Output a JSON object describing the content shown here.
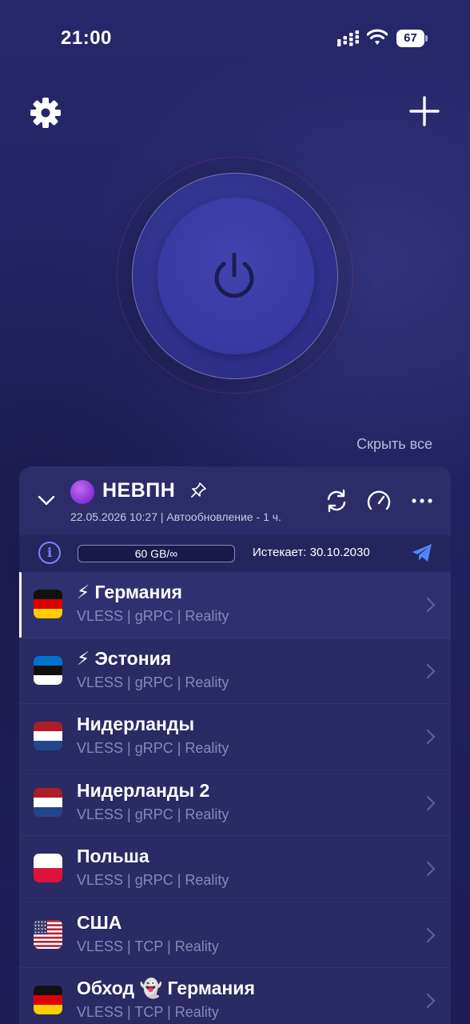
{
  "status_bar": {
    "time": "21:00",
    "battery": "67"
  },
  "hide_all_label": "Скрыть все",
  "subscription": {
    "emoji": "🟣",
    "name": "НЕВПН",
    "meta": "22.05.2026 10:27 | Автообновление - 1 ч.",
    "traffic": "60 GB/∞",
    "expires": "Истекает: 30.10.2030"
  },
  "servers": [
    {
      "name": "⚡ Германия",
      "protocol": "VLESS | gRPC | Reality",
      "flag": "de",
      "active": true
    },
    {
      "name": "⚡ Эстония",
      "protocol": "VLESS | gRPC | Reality",
      "flag": "ee",
      "active": false
    },
    {
      "name": "Нидерланды",
      "protocol": "VLESS | gRPC | Reality",
      "flag": "nl",
      "active": false
    },
    {
      "name": "Нидерланды 2",
      "protocol": "VLESS | gRPC | Reality",
      "flag": "nl",
      "active": false
    },
    {
      "name": "Польша",
      "protocol": "VLESS | gRPC | Reality",
      "flag": "pl",
      "active": false
    },
    {
      "name": "США",
      "protocol": "VLESS | TCP | Reality",
      "flag": "us",
      "active": false
    },
    {
      "name": "Обход 👻 Германия",
      "protocol": "VLESS | TCP | Reality",
      "flag": "de",
      "active": false
    }
  ],
  "colors": {
    "background": "#1f1e57",
    "card": "#2a2a64",
    "accent": "#7b84f0"
  }
}
